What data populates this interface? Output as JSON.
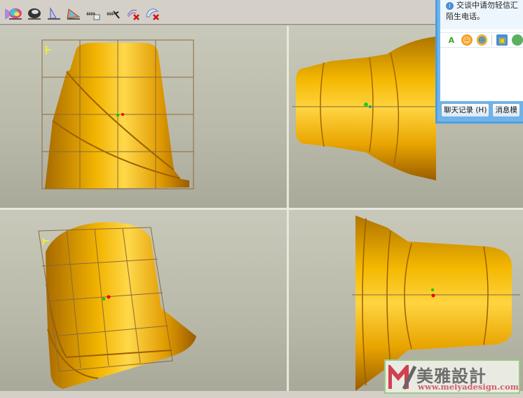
{
  "toolbar": {
    "icons": [
      "color-shade-icon",
      "render-icon",
      "draft-icon",
      "gradient-icon",
      "grid-insert-icon",
      "grid-cut-icon",
      "delete-curve-icon",
      "delete-surface-icon"
    ]
  },
  "viewports": [
    {
      "name": "front-view"
    },
    {
      "name": "side-view-right"
    },
    {
      "name": "isometric-view"
    },
    {
      "name": "side-view-left"
    }
  ],
  "chat": {
    "notice": "交谈中请勿轻信汇款、中奖信息、陌生电话。",
    "notice_line1": "交谈中请勿轻信汇",
    "notice_line2": "陌生电话。",
    "history_button": "聊天记录 (H)",
    "message_button": "消息模"
  },
  "watermark": {
    "name": "美雅設計",
    "url": "www.meiyadesign.com"
  },
  "colors": {
    "gold": "#e0a000",
    "accent": "#4d9ee0"
  }
}
